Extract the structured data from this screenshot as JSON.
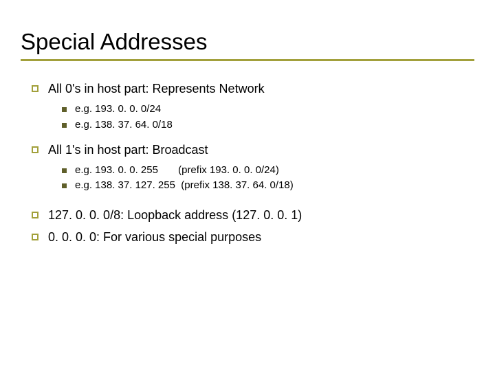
{
  "title": "Special Addresses",
  "items": [
    {
      "text": "All 0's in host part:  Represents Network",
      "sub": [
        "e.g. 193. 0. 0. 0/24",
        "e.g. 138. 37. 64. 0/18"
      ]
    },
    {
      "text": "All 1's in host part:    Broadcast",
      "sub": [
        "e.g. 193. 0. 0. 255       (prefix 193. 0. 0. 0/24)",
        "e.g. 138. 37. 127. 255  (prefix 138. 37. 64. 0/18)"
      ]
    },
    {
      "text": "127. 0. 0. 0/8: Loopback address (127. 0. 0. 1)",
      "sub": []
    },
    {
      "text": "0. 0. 0. 0: For various special purposes",
      "sub": []
    }
  ]
}
